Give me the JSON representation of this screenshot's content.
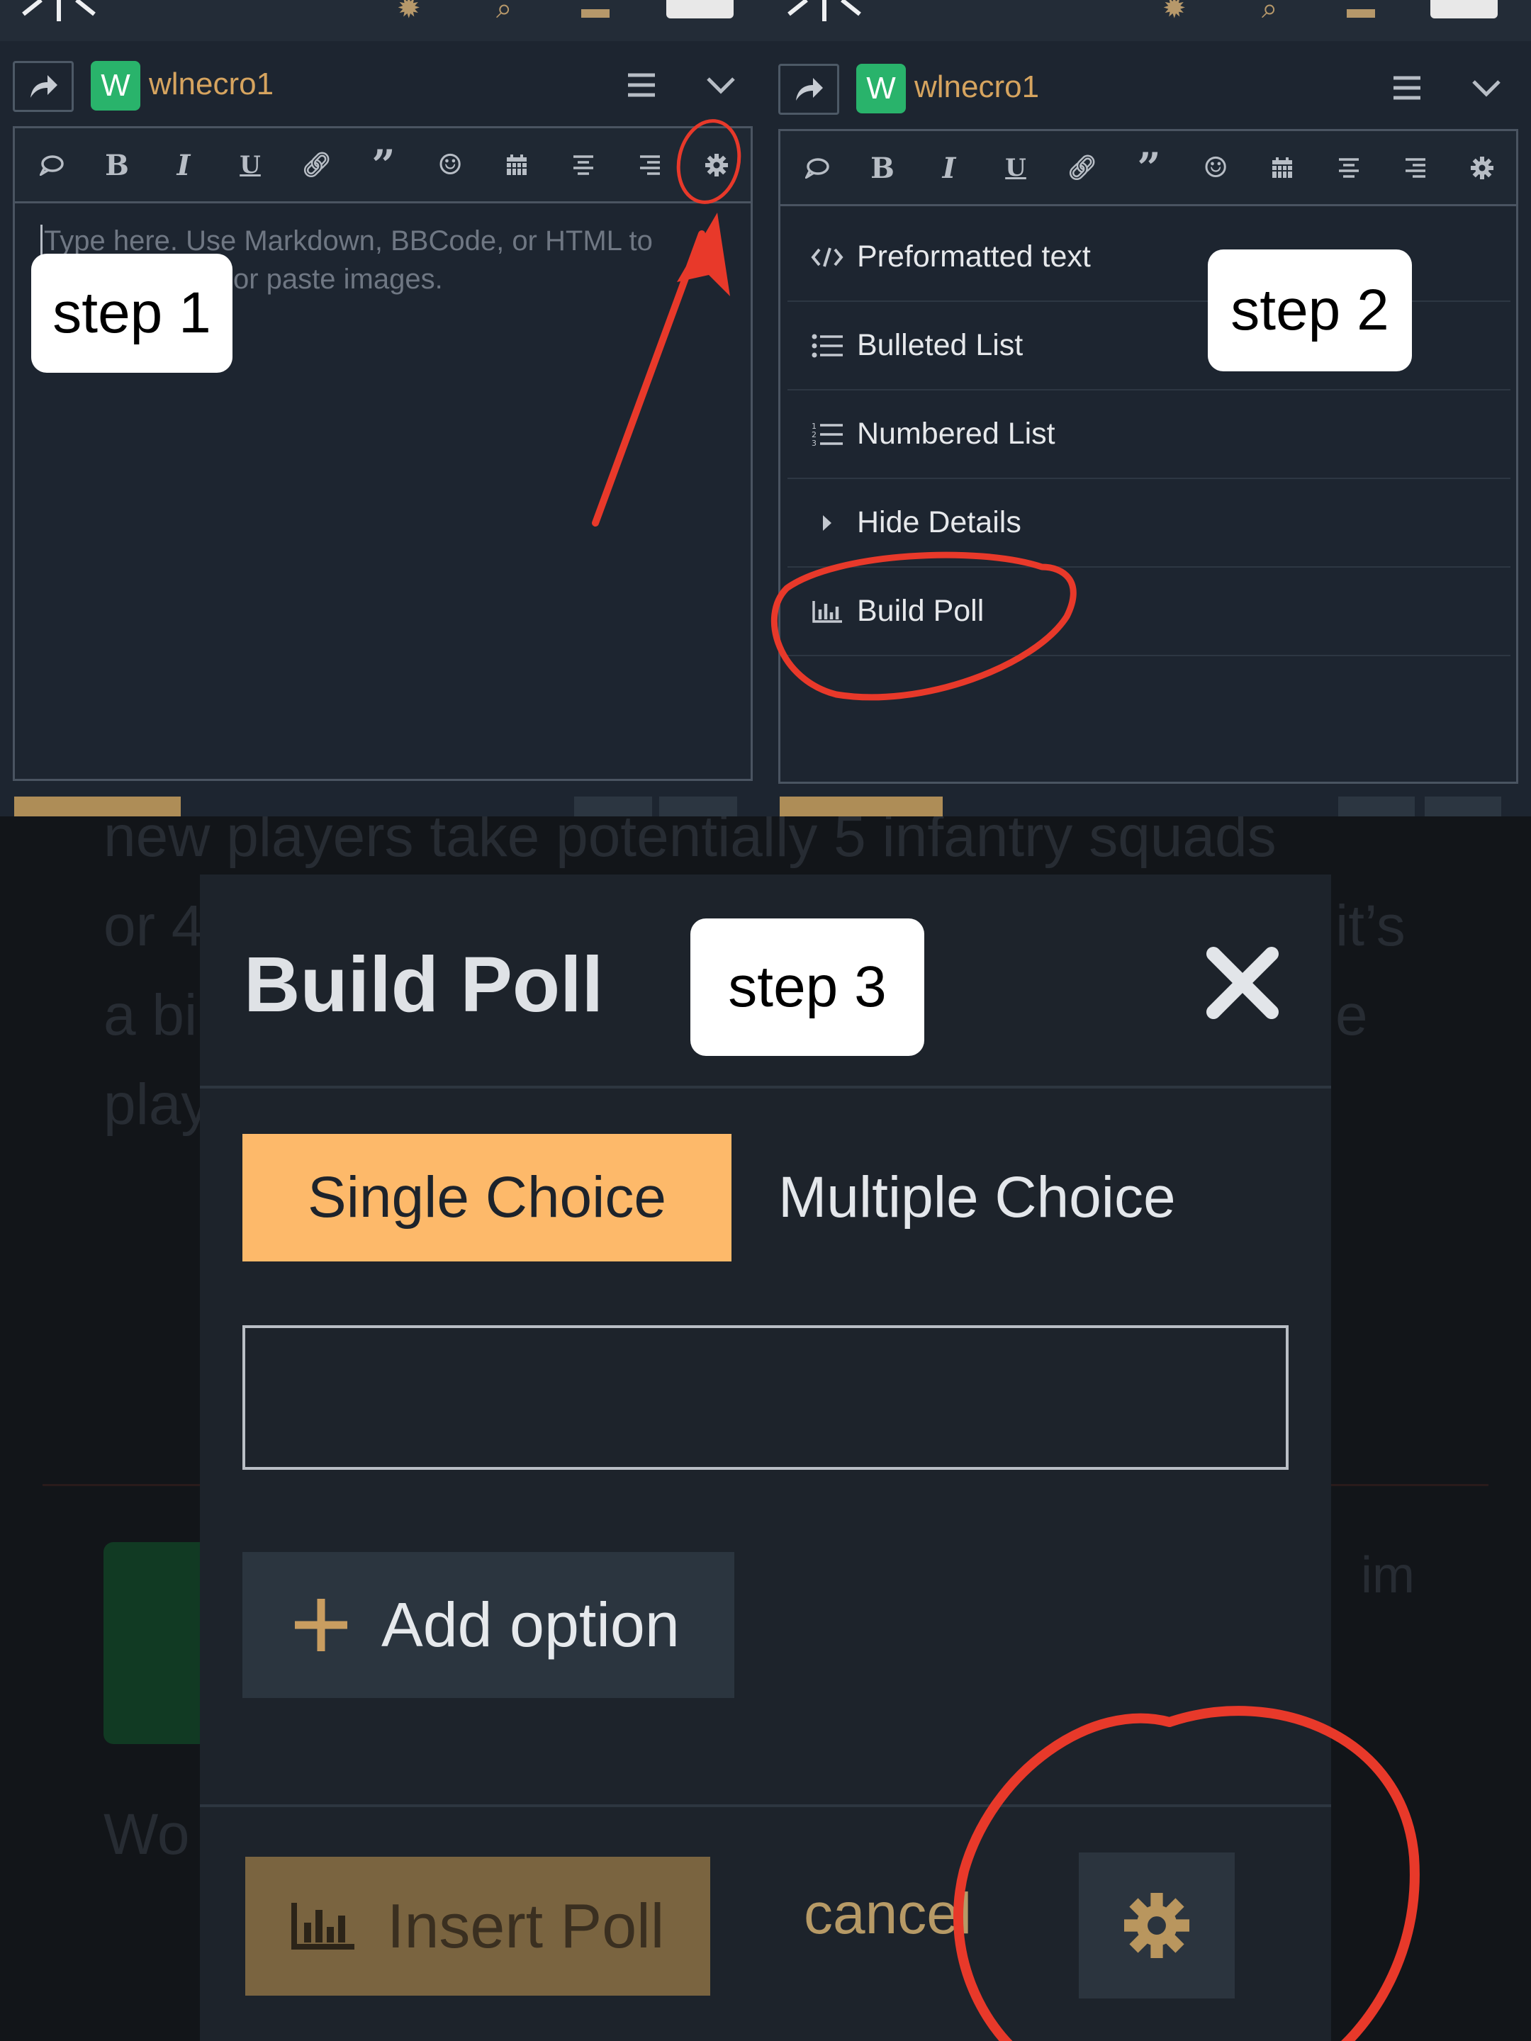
{
  "step_labels": {
    "step1": "step 1",
    "step2": "step 2",
    "step3": "step 3"
  },
  "editor": {
    "username": "wlnecro1",
    "avatar_letter": "W",
    "placeholder_line1": "Type here. Use Markdown, BBCode, or HTML to",
    "placeholder_line2": "or paste images."
  },
  "toolbar_icons": [
    "speech-bubble-icon",
    "bold-icon",
    "italic-icon",
    "underline-icon",
    "link-icon",
    "quote-icon",
    "emoji-icon",
    "calendar-icon",
    "align-center-icon",
    "align-right-icon",
    "gear-icon"
  ],
  "dropdown": {
    "items": [
      {
        "label": "Preformatted text",
        "icon": "code-icon"
      },
      {
        "label": "Bulleted List",
        "icon": "bulleted-list-icon"
      },
      {
        "label": "Numbered List",
        "icon": "numbered-list-icon"
      },
      {
        "label": "Hide Details",
        "icon": "caret-right-icon"
      },
      {
        "label": "Build Poll",
        "icon": "bar-chart-icon"
      }
    ]
  },
  "background_text": {
    "line1": "new players take potentially 5 infantry squads",
    "line2a": "or 4",
    "line2b": "it’s",
    "line3a": "a bi",
    "line3b": "e",
    "line4": "play",
    "line5": "im",
    "line6": "Wo"
  },
  "modal": {
    "title": "Build Poll",
    "tab_single": "Single Choice",
    "tab_multiple": "Multiple Choice",
    "option_value": "",
    "add_option": "Add option",
    "insert_poll": "Insert Poll",
    "cancel": "cancel"
  },
  "colors": {
    "accent_orange": "#fdb96a",
    "username_gold": "#d6a45f",
    "annotation_red": "#e8392a",
    "avatar_green": "#29b36b"
  }
}
